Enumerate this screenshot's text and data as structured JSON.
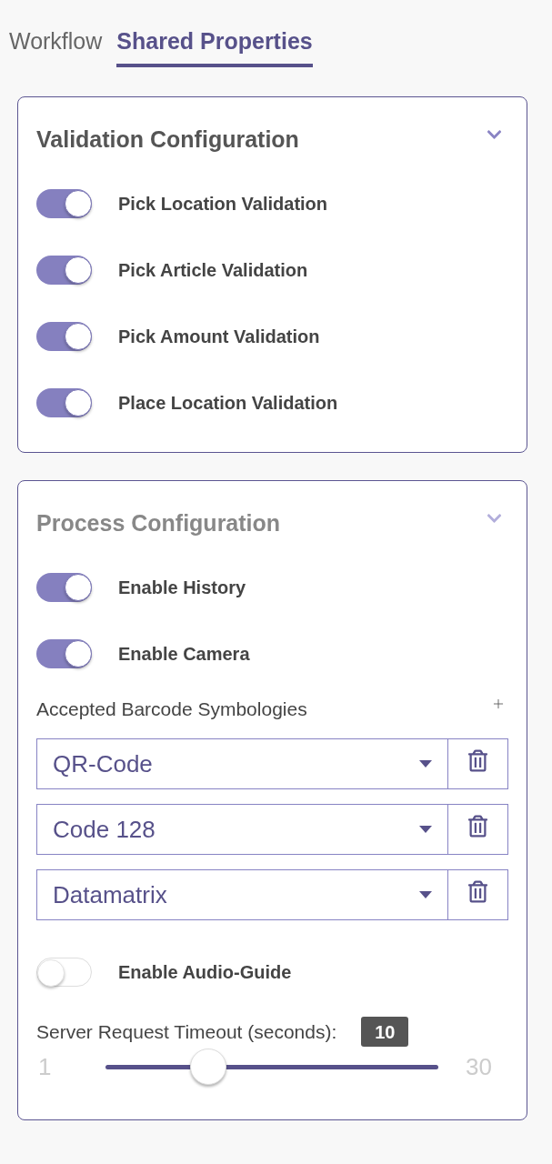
{
  "tabs": [
    {
      "label": "Workflow",
      "selected": false
    },
    {
      "label": "Shared Properties",
      "selected": true
    }
  ],
  "panels": [
    {
      "title": "Validation Configuration",
      "active": true,
      "expanded": true,
      "items": [
        {
          "kind": "toggle",
          "label": "Pick Location Validation",
          "on": true
        },
        {
          "kind": "toggle",
          "label": "Pick Article Validation",
          "on": true
        },
        {
          "kind": "toggle",
          "label": "Pick Amount Validation",
          "on": true
        },
        {
          "kind": "toggle",
          "label": "Place Location Validation",
          "on": true
        }
      ]
    },
    {
      "title": "Process Configuration",
      "active": false,
      "expanded": true,
      "items": [
        {
          "kind": "toggle",
          "label": "Enable History",
          "on": true
        },
        {
          "kind": "toggle",
          "label": "Enable Camera",
          "on": true
        },
        {
          "kind": "list",
          "label": "Accepted Barcode Symbologies",
          "entries": [
            "QR-Code",
            "Code 128",
            "Datamatrix"
          ]
        },
        {
          "kind": "toggle",
          "label": "Enable Audio-Guide",
          "on": false
        },
        {
          "kind": "slider",
          "label": "Server Request Timeout (seconds):",
          "value": "10",
          "min": "1",
          "max": "30",
          "level": 0.31
        }
      ]
    }
  ]
}
